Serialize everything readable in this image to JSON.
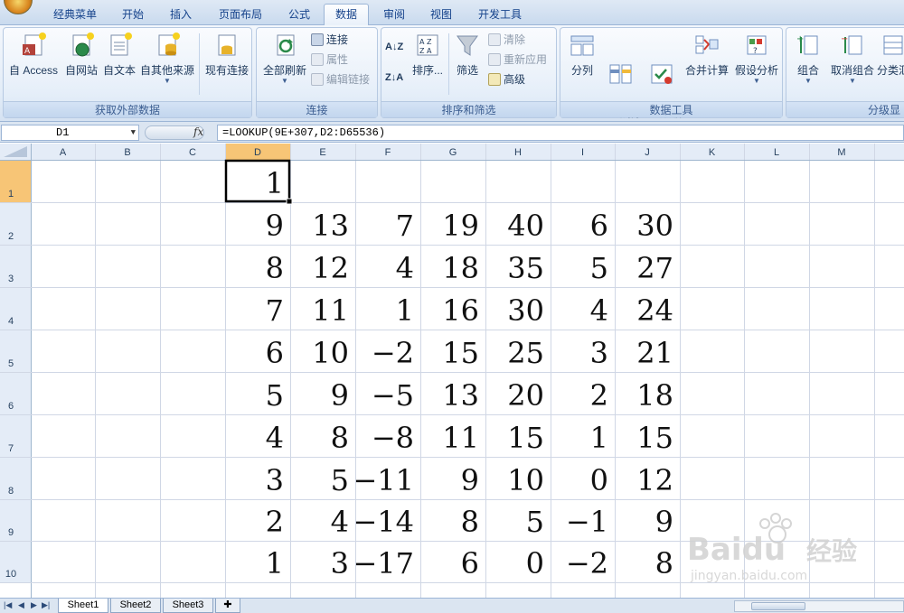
{
  "tabs": [
    "经典菜单",
    "开始",
    "插入",
    "页面布局",
    "公式",
    "数据",
    "审阅",
    "视图",
    "开发工具"
  ],
  "active_tab": "数据",
  "ribbon": {
    "groups": {
      "external": {
        "title": "获取外部数据",
        "buttons": [
          "自 Access",
          "自网站",
          "自文本",
          "自其他来源",
          "现有连接"
        ]
      },
      "connections": {
        "title": "连接",
        "refresh": "全部刷新",
        "small": [
          "连接",
          "属性",
          "编辑链接"
        ]
      },
      "sort_filter": {
        "title": "排序和筛选",
        "sort": "排序...",
        "filter": "筛选",
        "small": [
          "清除",
          "重新应用",
          "高级"
        ]
      },
      "data_tools": {
        "title": "数据工具",
        "buttons": [
          "分列",
          "删除\n重复项",
          "数据\n有效性",
          "合并计算",
          "假设分析"
        ]
      },
      "outline": {
        "title": "分级显",
        "buttons": [
          "组合",
          "取消组合",
          "分类汇"
        ]
      }
    }
  },
  "formula_bar": {
    "name_box": "D1",
    "fx": "fx",
    "formula": "=LOOKUP(9E+307,D2:D65536)"
  },
  "columns": [
    "A",
    "B",
    "C",
    "D",
    "E",
    "F",
    "G",
    "H",
    "I",
    "J",
    "K",
    "L",
    "M"
  ],
  "rows": [
    "1",
    "2",
    "3",
    "4",
    "5",
    "6",
    "7",
    "8",
    "9",
    "10"
  ],
  "cells": [
    [
      "",
      "",
      "",
      "1",
      "",
      "",
      "",
      "",
      "",
      ""
    ],
    [
      "",
      "",
      "",
      "9",
      "13",
      "7",
      "19",
      "40",
      "6",
      "30"
    ],
    [
      "",
      "",
      "",
      "8",
      "12",
      "4",
      "18",
      "35",
      "5",
      "27"
    ],
    [
      "",
      "",
      "",
      "7",
      "11",
      "1",
      "16",
      "30",
      "4",
      "24"
    ],
    [
      "",
      "",
      "",
      "6",
      "10",
      "−2",
      "15",
      "25",
      "3",
      "21"
    ],
    [
      "",
      "",
      "",
      "5",
      "9",
      "−5",
      "13",
      "20",
      "2",
      "18"
    ],
    [
      "",
      "",
      "",
      "4",
      "8",
      "−8",
      "11",
      "15",
      "1",
      "15"
    ],
    [
      "",
      "",
      "",
      "3",
      "5",
      "−11",
      "9",
      "10",
      "0",
      "12"
    ],
    [
      "",
      "",
      "",
      "2",
      "4",
      "−14",
      "8",
      "5",
      "−1",
      "9"
    ],
    [
      "",
      "",
      "",
      "1",
      "3",
      "−17",
      "6",
      "0",
      "−2",
      "8"
    ]
  ],
  "selected_cell": "D1",
  "sheets": [
    "Sheet1",
    "Sheet2",
    "Sheet3"
  ],
  "active_sheet": "Sheet1",
  "watermark": {
    "brand": "Baidu",
    "cn": "经验",
    "url": "jingyan.baidu.com"
  },
  "colors": {
    "ribbon_bg": "#dfe9f5",
    "selected_header": "#f7c576",
    "grid_line": "#d0d7e5"
  }
}
